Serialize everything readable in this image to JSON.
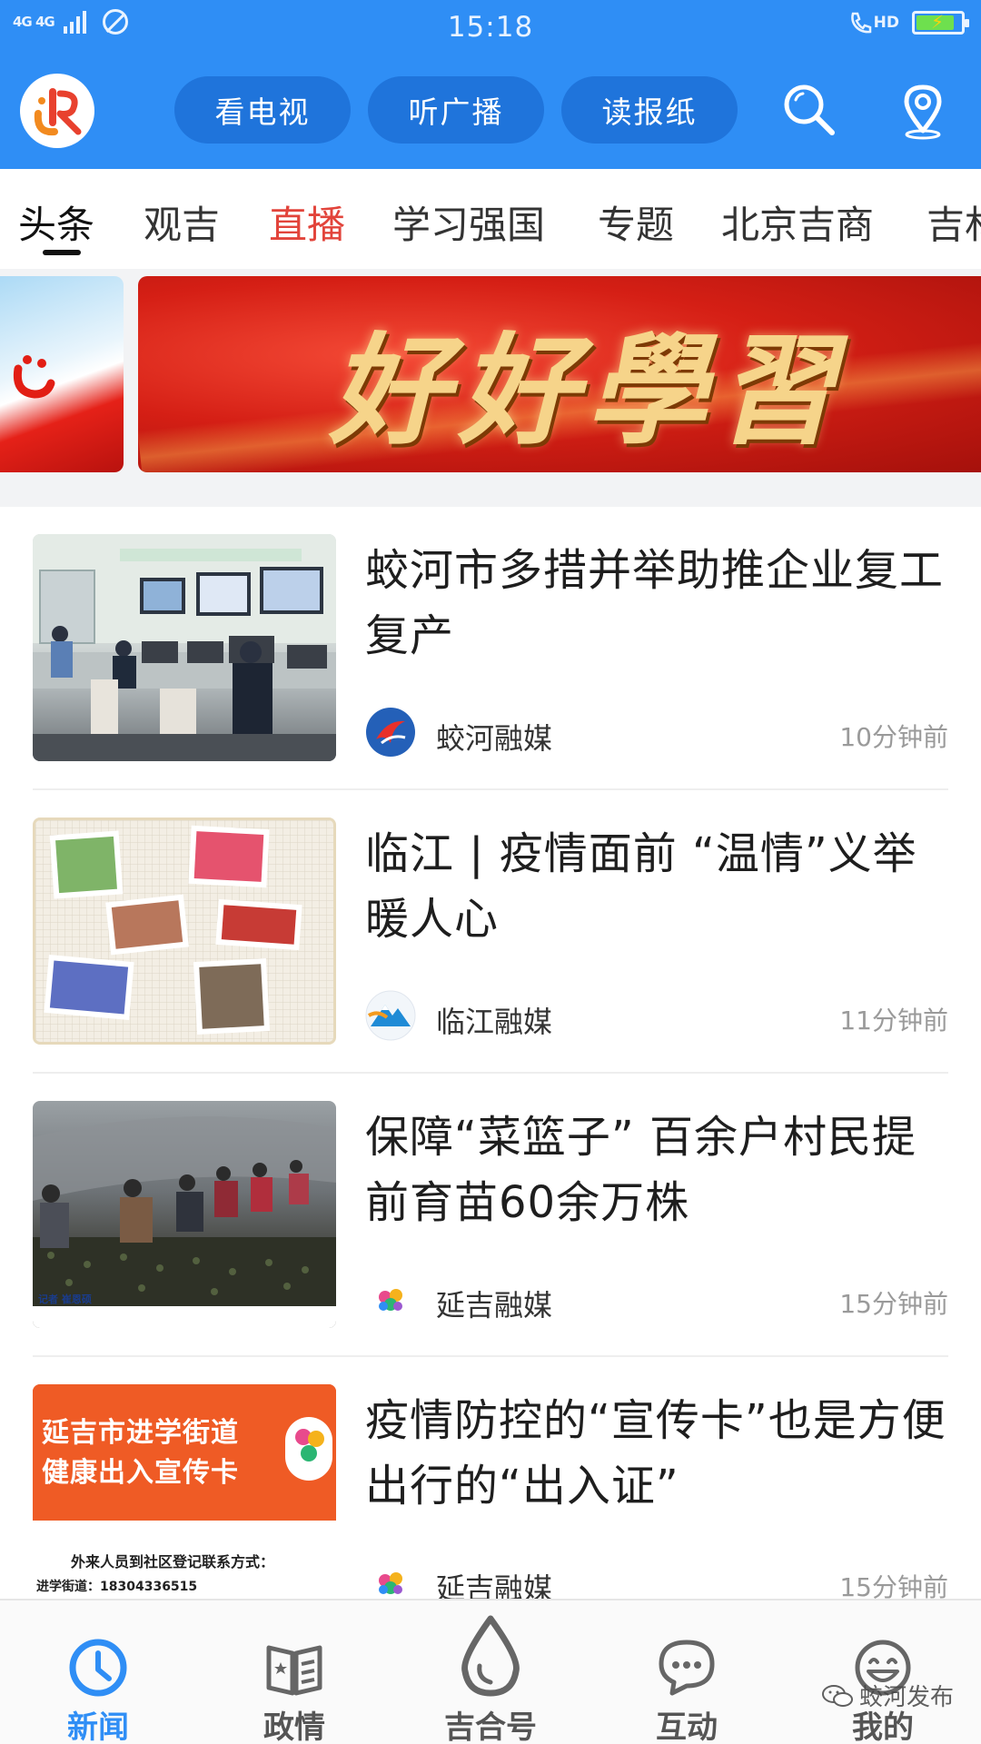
{
  "status_bar": {
    "network": "4G 4G",
    "time": "15:18",
    "hd": "HD",
    "battery_level": 0.85
  },
  "header": {
    "buttons": [
      "看电视",
      "听广播",
      "读报纸"
    ],
    "icons": [
      "search-icon",
      "location-pin-icon"
    ]
  },
  "tabs": [
    {
      "label": "头条",
      "active": true
    },
    {
      "label": "观吉"
    },
    {
      "label": "直播",
      "highlight_color": "#e2443b"
    },
    {
      "label": "学习强国"
    },
    {
      "label": "专题"
    },
    {
      "label": "北京吉商"
    },
    {
      "label": "吉林"
    }
  ],
  "banner": {
    "text": "好好學習"
  },
  "news": [
    {
      "title": "蛟河市多措并举助推企业复工复产",
      "source": "蛟河融媒",
      "time": "10分钟前"
    },
    {
      "title": "临江 | 疫情面前 “温情”义举暖人心",
      "source": "临江融媒",
      "time": "11分钟前"
    },
    {
      "title": "保障“菜篮子” 百余户村民提前育苗60余万株",
      "source": "延吉融媒",
      "time": "15分钟前",
      "thumb_caption": "记者  崔恩硕"
    },
    {
      "title": "疫情防控的“宣传卡”也是方便出行的“出入证”",
      "source": "延吉融媒",
      "time": "15分钟前",
      "thumb_lines": [
        "延吉市进学街道",
        "健康出入宣传卡",
        "外来人员到社区登记联系方式：",
        "进学街道：18304336515"
      ]
    }
  ],
  "bottom_nav": [
    {
      "label": "新闻",
      "icon": "clock-icon",
      "active": true
    },
    {
      "label": "政情",
      "icon": "book-icon"
    },
    {
      "label": "吉合号",
      "icon": "drop-icon"
    },
    {
      "label": "互动",
      "icon": "chat-icon"
    },
    {
      "label": "我的",
      "icon": "smile-icon"
    }
  ],
  "watermark": "蛟河发布",
  "colors": {
    "brand_blue": "#2f8ef5",
    "pill_blue": "#1f74db",
    "live_red": "#e2443b",
    "active_nav": "#2f8ef5"
  }
}
